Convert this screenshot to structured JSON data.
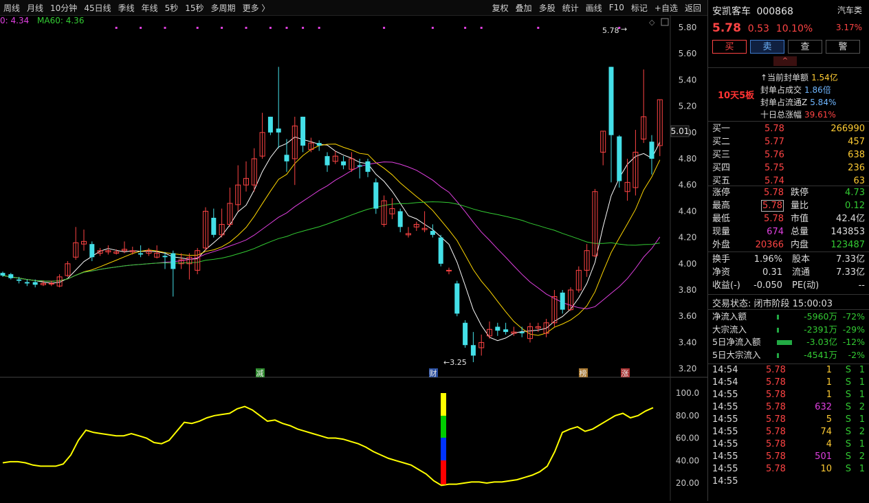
{
  "toolbar": {
    "periods": [
      "周线",
      "月线",
      "10分钟",
      "45日线",
      "季线",
      "年线",
      "5秒",
      "15秒",
      "多周期",
      "更多 〉"
    ],
    "tools": [
      "复权",
      "叠加",
      "多股",
      "统计",
      "画线",
      "F10",
      "标记",
      "+自选",
      "返回"
    ]
  },
  "ma_legend": {
    "ma_text": "0: 4.34",
    "ma_color": "#e040e0",
    "ma60_text": "MA60: 4.36",
    "ma60_color": "#33cc33"
  },
  "price_axis": [
    "5.80",
    "5.60",
    "5.40",
    "5.20",
    "5.00",
    "4.80",
    "4.60",
    "4.40",
    "4.20",
    "4.00",
    "3.80",
    "3.60",
    "3.40",
    "3.20"
  ],
  "price_marker": "5.01",
  "annotations": {
    "high_label": "5.78",
    "low_label": "3.25",
    "tags": [
      "减",
      "财",
      "榜",
      "涨"
    ]
  },
  "sub_axis": [
    "100.0",
    "80.00",
    "60.00",
    "40.00",
    "20.00"
  ],
  "quote": {
    "name": "安凯客车",
    "code": "000868",
    "sector": "汽车类",
    "price": "5.78",
    "change": "0.53",
    "pct": "10.10%",
    "sector_pct": "3.17%",
    "buttons": [
      "买",
      "卖",
      "查",
      "警"
    ],
    "collapse_icon": "^",
    "board_tag": "10天5板",
    "seal": [
      {
        "label": "↑当前封单额",
        "value": "1.54亿",
        "color": "#ffcc33"
      },
      {
        "label": "封单占成交",
        "value": "1.86倍",
        "color": "#6fb6ff"
      },
      {
        "label": "封单占流通Z",
        "value": "5.84%",
        "color": "#6fb6ff"
      },
      {
        "label": "十日总涨幅",
        "value": "39.61%",
        "color": "#ff4444"
      }
    ]
  },
  "order_book": [
    {
      "label": "买一",
      "price": "5.78",
      "vol": "266990"
    },
    {
      "label": "买二",
      "price": "5.77",
      "vol": "457"
    },
    {
      "label": "买三",
      "price": "5.76",
      "vol": "638"
    },
    {
      "label": "买四",
      "price": "5.75",
      "vol": "236"
    },
    {
      "label": "买五",
      "price": "5.74",
      "vol": "63"
    }
  ],
  "stats": [
    {
      "k1": "涨停",
      "v1": "5.78",
      "c1": "#ff4444",
      "k2": "跌停",
      "v2": "4.73",
      "c2": "#33cc33"
    },
    {
      "k1": "最高",
      "v1": "5.78",
      "c1": "#ff4444",
      "k2": "量比",
      "v2": "0.12",
      "c2": "#33cc33"
    },
    {
      "k1": "最低",
      "v1": "5.78",
      "c1": "#ff4444",
      "k2": "市值",
      "v2": "42.4亿",
      "c2": "#dddddd"
    },
    {
      "k1": "现量",
      "v1": "674",
      "c1": "#e040e0",
      "k2": "总量",
      "v2": "143853",
      "c2": "#dddddd"
    },
    {
      "k1": "外盘",
      "v1": "20366",
      "c1": "#ff4444",
      "k2": "内盘",
      "v2": "123487",
      "c2": "#33cc33"
    }
  ],
  "stats2": [
    {
      "k1": "换手",
      "v1": "1.96%",
      "k2": "股本",
      "v2": "7.33亿"
    },
    {
      "k1": "净资",
      "v1": "0.31",
      "k2": "流通",
      "v2": "7.33亿"
    },
    {
      "k1": "收益(-)",
      "v1": "-0.050",
      "k2": "PE(动)",
      "v2": "--"
    }
  ],
  "trade_status": "交易状态: 闭市阶段 15:00:03",
  "flows": [
    {
      "label": "净流入额",
      "value": "-5960万",
      "pct": "-72%"
    },
    {
      "label": "大宗流入",
      "value": "-2391万",
      "pct": "-29%"
    },
    {
      "label": "5日净流入额",
      "value": "-3.03亿",
      "pct": "-12%"
    },
    {
      "label": "5日大宗流入",
      "value": "-4541万",
      "pct": "-2%"
    }
  ],
  "ticks": [
    {
      "t": "14:54",
      "p": "5.78",
      "v": "1",
      "vc": "#ffcc33",
      "s": "S",
      "n": "1"
    },
    {
      "t": "14:54",
      "p": "5.78",
      "v": "1",
      "vc": "#ffcc33",
      "s": "S",
      "n": "1"
    },
    {
      "t": "14:55",
      "p": "5.78",
      "v": "1",
      "vc": "#ffcc33",
      "s": "S",
      "n": "1"
    },
    {
      "t": "14:55",
      "p": "5.78",
      "v": "632",
      "vc": "#e040e0",
      "s": "S",
      "n": "2"
    },
    {
      "t": "14:55",
      "p": "5.78",
      "v": "5",
      "vc": "#ffcc33",
      "s": "S",
      "n": "1"
    },
    {
      "t": "14:55",
      "p": "5.78",
      "v": "74",
      "vc": "#ffcc33",
      "s": "S",
      "n": "2"
    },
    {
      "t": "14:55",
      "p": "5.78",
      "v": "4",
      "vc": "#ffcc33",
      "s": "S",
      "n": "1"
    },
    {
      "t": "14:55",
      "p": "5.78",
      "v": "501",
      "vc": "#e040e0",
      "s": "S",
      "n": "2"
    },
    {
      "t": "14:55",
      "p": "5.78",
      "v": "10",
      "vc": "#ffcc33",
      "s": "S",
      "n": "1"
    },
    {
      "t": "14:55",
      "p": "",
      "v": "",
      "vc": "#ffcc33",
      "s": "",
      "n": ""
    }
  ],
  "colors": {
    "up": "#ff4444",
    "down": "#44e0e8",
    "ma5": "#ffffff",
    "ma10": "#ffd700",
    "ma30": "#e040e0",
    "ma60": "#33cc33",
    "osc": "#ffff00"
  }
}
